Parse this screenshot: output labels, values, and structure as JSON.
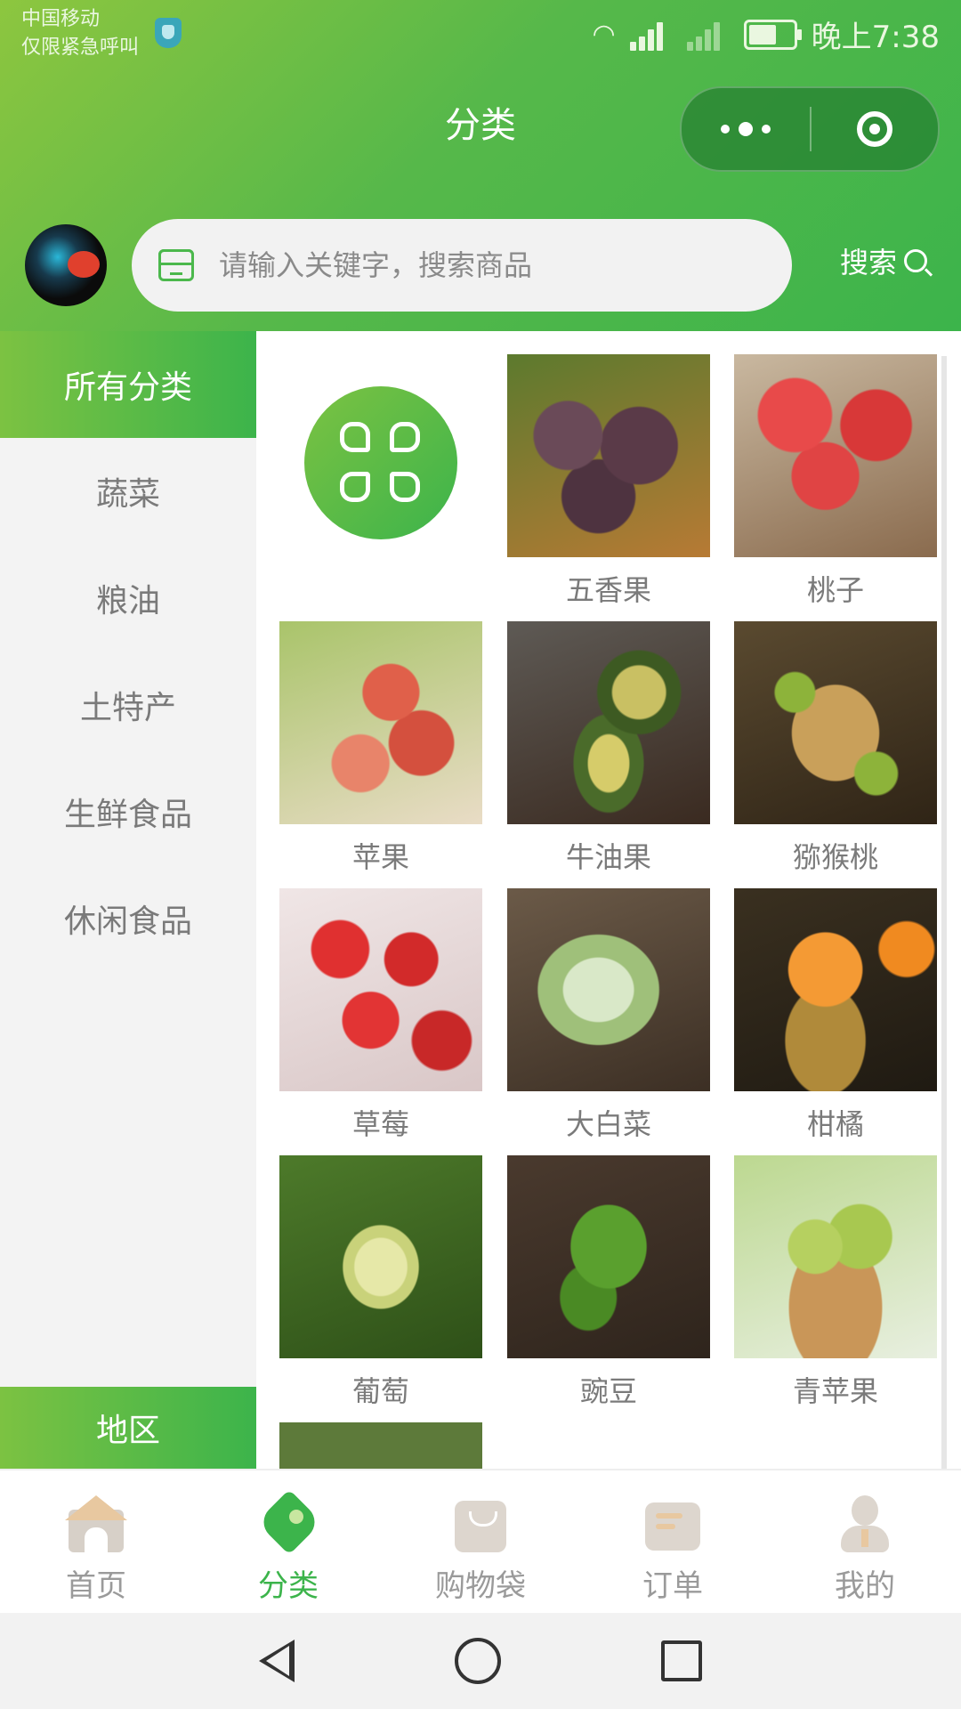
{
  "status": {
    "carrier_line1": "中国移动",
    "carrier_line2": "仅限紧急呼叫",
    "time": "晚上7:38"
  },
  "header": {
    "title": "分类",
    "search_placeholder": "请输入关键字，搜索商品",
    "search_button": "搜索"
  },
  "sidebar": {
    "items": [
      {
        "label": "所有分类",
        "active": true
      },
      {
        "label": "蔬菜"
      },
      {
        "label": "粮油"
      },
      {
        "label": "土特产"
      },
      {
        "label": "生鲜食品"
      },
      {
        "label": "休闲食品"
      }
    ],
    "region": "地区"
  },
  "products": [
    {
      "name": "五香果",
      "icon": "mangosteen-image",
      "color": "#5a3a46"
    },
    {
      "name": "桃子",
      "icon": "peach-image",
      "color": "#d23a3a"
    },
    {
      "name": "苹果",
      "icon": "apple-tree-image",
      "color": "#d9563e"
    },
    {
      "name": "牛油果",
      "icon": "avocado-image",
      "color": "#56612b"
    },
    {
      "name": "猕猴桃",
      "icon": "kiwi-image",
      "color": "#7b6a3c"
    },
    {
      "name": "草莓",
      "icon": "strawberry-image",
      "color": "#cf2a2a"
    },
    {
      "name": "大白菜",
      "icon": "cabbage-image",
      "color": "#9ab57c"
    },
    {
      "name": "柑橘",
      "icon": "tangerine-image",
      "color": "#e08a22"
    },
    {
      "name": "葡萄",
      "icon": "grape-image",
      "color": "#5b8a2a"
    },
    {
      "name": "豌豆",
      "icon": "peas-image",
      "color": "#3f6b2b"
    },
    {
      "name": "青苹果",
      "icon": "green-apple-image",
      "color": "#a9c25a"
    },
    {
      "name": "",
      "icon": "carrot-image",
      "color": "#8b6a4e"
    }
  ],
  "tabbar": {
    "items": [
      {
        "label": "首页",
        "icon": "home-icon"
      },
      {
        "label": "分类",
        "icon": "tag-icon",
        "active": true
      },
      {
        "label": "购物袋",
        "icon": "bag-icon"
      },
      {
        "label": "订单",
        "icon": "order-icon"
      },
      {
        "label": "我的",
        "icon": "user-icon"
      }
    ]
  },
  "colors": {
    "accent": "#3cb44b",
    "accent_light": "#8dc63f"
  }
}
